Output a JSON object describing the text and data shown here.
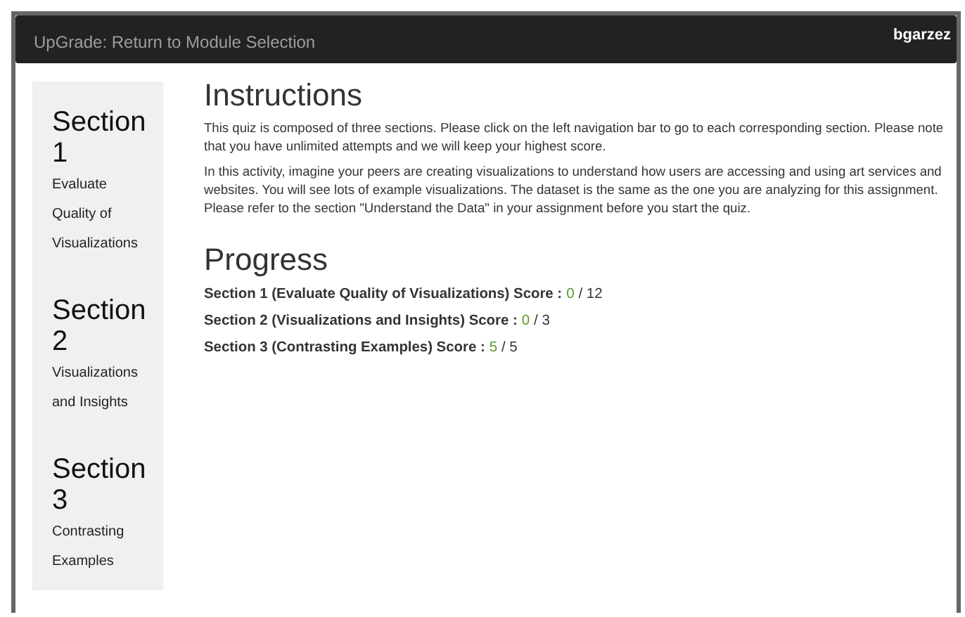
{
  "navbar": {
    "title": "UpGrade: Return to Module Selection",
    "user": "bgarzez"
  },
  "sidebar": {
    "items": [
      {
        "heading": "Section 1",
        "subtitle": "Evaluate Quality of Visualizations"
      },
      {
        "heading": "Section 2",
        "subtitle": "Visualizations and Insights"
      },
      {
        "heading": "Section 3",
        "subtitle": "Contrasting Examples"
      }
    ]
  },
  "instructions": {
    "title": "Instructions",
    "paragraphs": [
      "This quiz is composed of three sections. Please click on the left navigation bar to go to each corresponding section. Please note that you have unlimited attempts and we will keep your highest score.",
      "In this activity, imagine your peers are creating visualizations to understand how users are accessing and using art services and websites. You will see lots of example visualizations. The dataset is the same as the one you are analyzing for this assignment. Please refer to the section \"Understand the Data\" in your assignment before you start the quiz."
    ]
  },
  "progress": {
    "title": "Progress",
    "rows": [
      {
        "label": "Section 1 (Evaluate Quality of Visualizations) Score :",
        "score": "0",
        "total": "/ 12"
      },
      {
        "label": "Section 2 (Visualizations and Insights) Score :",
        "score": "0",
        "total": "/ 3"
      },
      {
        "label": "Section 3 (Contrasting Examples) Score :",
        "score": "5",
        "total": "/ 5"
      }
    ]
  }
}
